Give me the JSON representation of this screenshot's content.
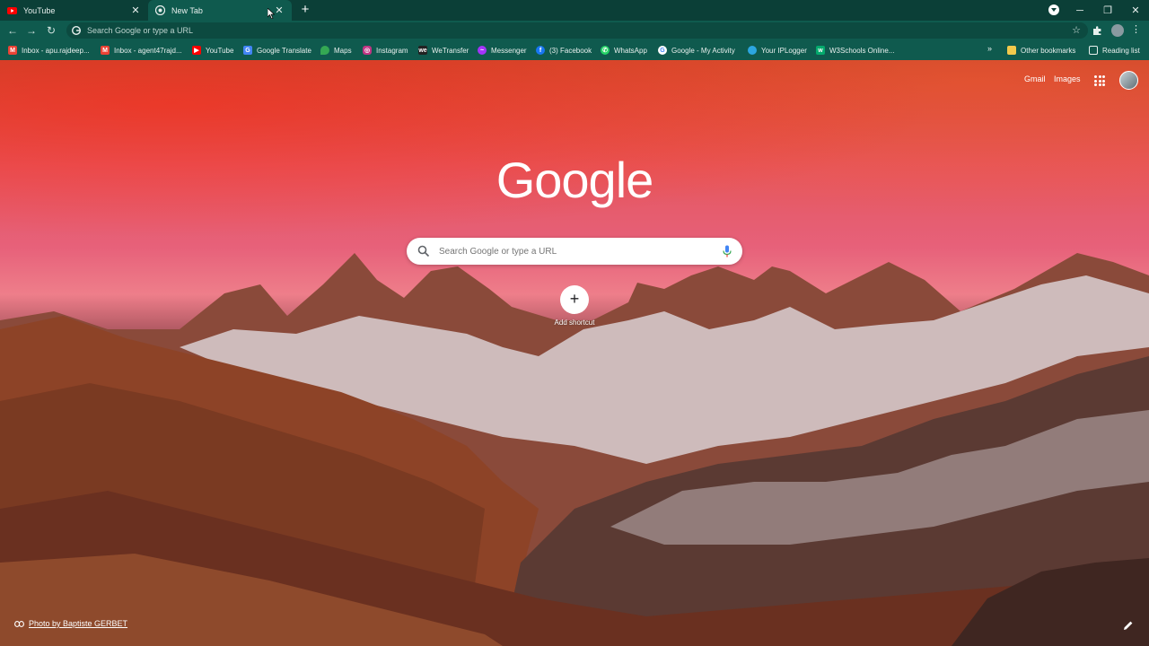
{
  "tabs": [
    {
      "title": "YouTube",
      "favicon": "youtube-icon",
      "active": false
    },
    {
      "title": "New Tab",
      "favicon": "chrome-icon",
      "active": true
    }
  ],
  "toolbar": {
    "omnibox_placeholder": "Search Google or type a URL"
  },
  "bookmarks": [
    {
      "label": "Inbox - apu.rajdeep...",
      "icon": "gmail-icon",
      "color": "#EA4335"
    },
    {
      "label": "Inbox - agent47rajd...",
      "icon": "gmail-icon",
      "color": "#EA4335"
    },
    {
      "label": "YouTube",
      "icon": "youtube-icon",
      "color": "#FF0000"
    },
    {
      "label": "Google Translate",
      "icon": "translate-icon",
      "color": "#4285F4"
    },
    {
      "label": "Maps",
      "icon": "maps-icon",
      "color": "#34A853"
    },
    {
      "label": "Instagram",
      "icon": "instagram-icon",
      "color": "#C13584"
    },
    {
      "label": "WeTransfer",
      "icon": "wetransfer-icon",
      "color": "#222222"
    },
    {
      "label": "Messenger",
      "icon": "messenger-icon",
      "color": "#A334FA"
    },
    {
      "label": "(3) Facebook",
      "icon": "facebook-icon",
      "color": "#1877F2"
    },
    {
      "label": "WhatsApp",
      "icon": "whatsapp-icon",
      "color": "#25D366"
    },
    {
      "label": "Google - My Activity",
      "icon": "google-icon",
      "color": "#FFFFFF"
    },
    {
      "label": "Your IPLogger",
      "icon": "iplogger-icon",
      "color": "#2CA6E0"
    },
    {
      "label": "W3Schools Online...",
      "icon": "w3schools-icon",
      "color": "#04AA6D"
    }
  ],
  "bookmarks_right": {
    "other_bookmarks": "Other bookmarks",
    "reading_list": "Reading list"
  },
  "ntp": {
    "gmail": "Gmail",
    "images": "Images",
    "logo": "Google",
    "search_placeholder": "Search Google or type a URL",
    "add_shortcut": "Add shortcut",
    "photo_credit": "Photo by Baptiste GERBET"
  }
}
